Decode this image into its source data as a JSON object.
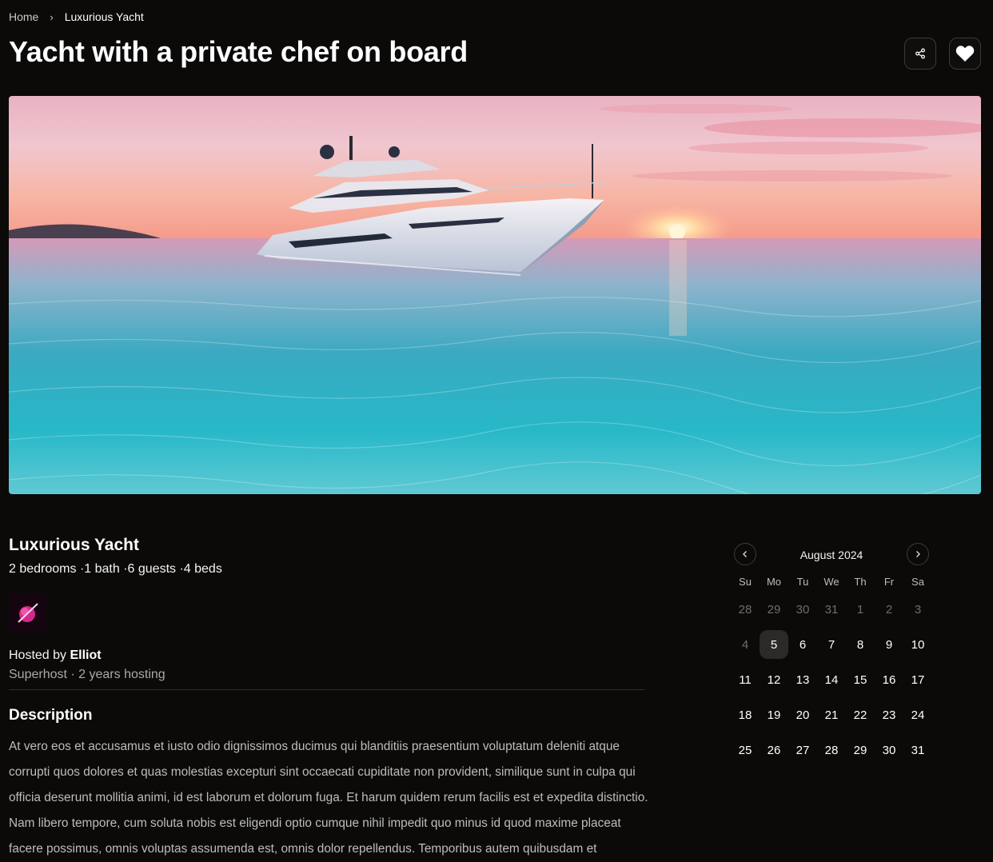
{
  "breadcrumb": {
    "home": "Home",
    "separator": "›",
    "current": "Luxurious Yacht"
  },
  "page_title": "Yacht with a private chef on board",
  "actions": {
    "share_icon": "share-icon",
    "favorite_icon": "heart-icon"
  },
  "hero": {
    "alt": "Yacht at sunset on turquoise water"
  },
  "listing": {
    "title": "Luxurious Yacht",
    "specs": "2 bedrooms ·1 bath ·6 guests ·4 beds"
  },
  "host": {
    "prefix": "Hosted by ",
    "name": "Elliot",
    "meta": "Superhost · 2 years hosting"
  },
  "description": {
    "title": "Description",
    "body": "At vero eos et accusamus et iusto odio dignissimos ducimus qui blanditiis praesentium voluptatum deleniti atque corrupti quos dolores et quas molestias excepturi sint occaecati cupiditate non provident, similique sunt in culpa qui officia deserunt mollitia animi, id est laborum et dolorum fuga. Et harum quidem rerum facilis est et expedita distinctio. Nam libero tempore, cum soluta nobis est eligendi optio cumque nihil impedit quo minus id quod maxime placeat facere possimus, omnis voluptas assumenda est, omnis dolor repellendus. Temporibus autem quibusdam et"
  },
  "calendar": {
    "month_label": "August 2024",
    "prev_icon": "chevron-left-icon",
    "next_icon": "chevron-right-icon",
    "weekdays": [
      "Su",
      "Mo",
      "Tu",
      "We",
      "Th",
      "Fr",
      "Sa"
    ],
    "days": [
      {
        "d": "28",
        "muted": true
      },
      {
        "d": "29",
        "muted": true
      },
      {
        "d": "30",
        "muted": true
      },
      {
        "d": "31",
        "muted": true
      },
      {
        "d": "1",
        "muted": true
      },
      {
        "d": "2",
        "muted": true
      },
      {
        "d": "3",
        "muted": true
      },
      {
        "d": "4",
        "muted": true
      },
      {
        "d": "5",
        "selected": true
      },
      {
        "d": "6"
      },
      {
        "d": "7"
      },
      {
        "d": "8"
      },
      {
        "d": "9"
      },
      {
        "d": "10"
      },
      {
        "d": "11"
      },
      {
        "d": "12"
      },
      {
        "d": "13"
      },
      {
        "d": "14"
      },
      {
        "d": "15"
      },
      {
        "d": "16"
      },
      {
        "d": "17"
      },
      {
        "d": "18"
      },
      {
        "d": "19"
      },
      {
        "d": "20"
      },
      {
        "d": "21"
      },
      {
        "d": "22"
      },
      {
        "d": "23"
      },
      {
        "d": "24"
      },
      {
        "d": "25"
      },
      {
        "d": "26"
      },
      {
        "d": "27"
      },
      {
        "d": "28"
      },
      {
        "d": "29"
      },
      {
        "d": "30"
      },
      {
        "d": "31"
      }
    ]
  }
}
